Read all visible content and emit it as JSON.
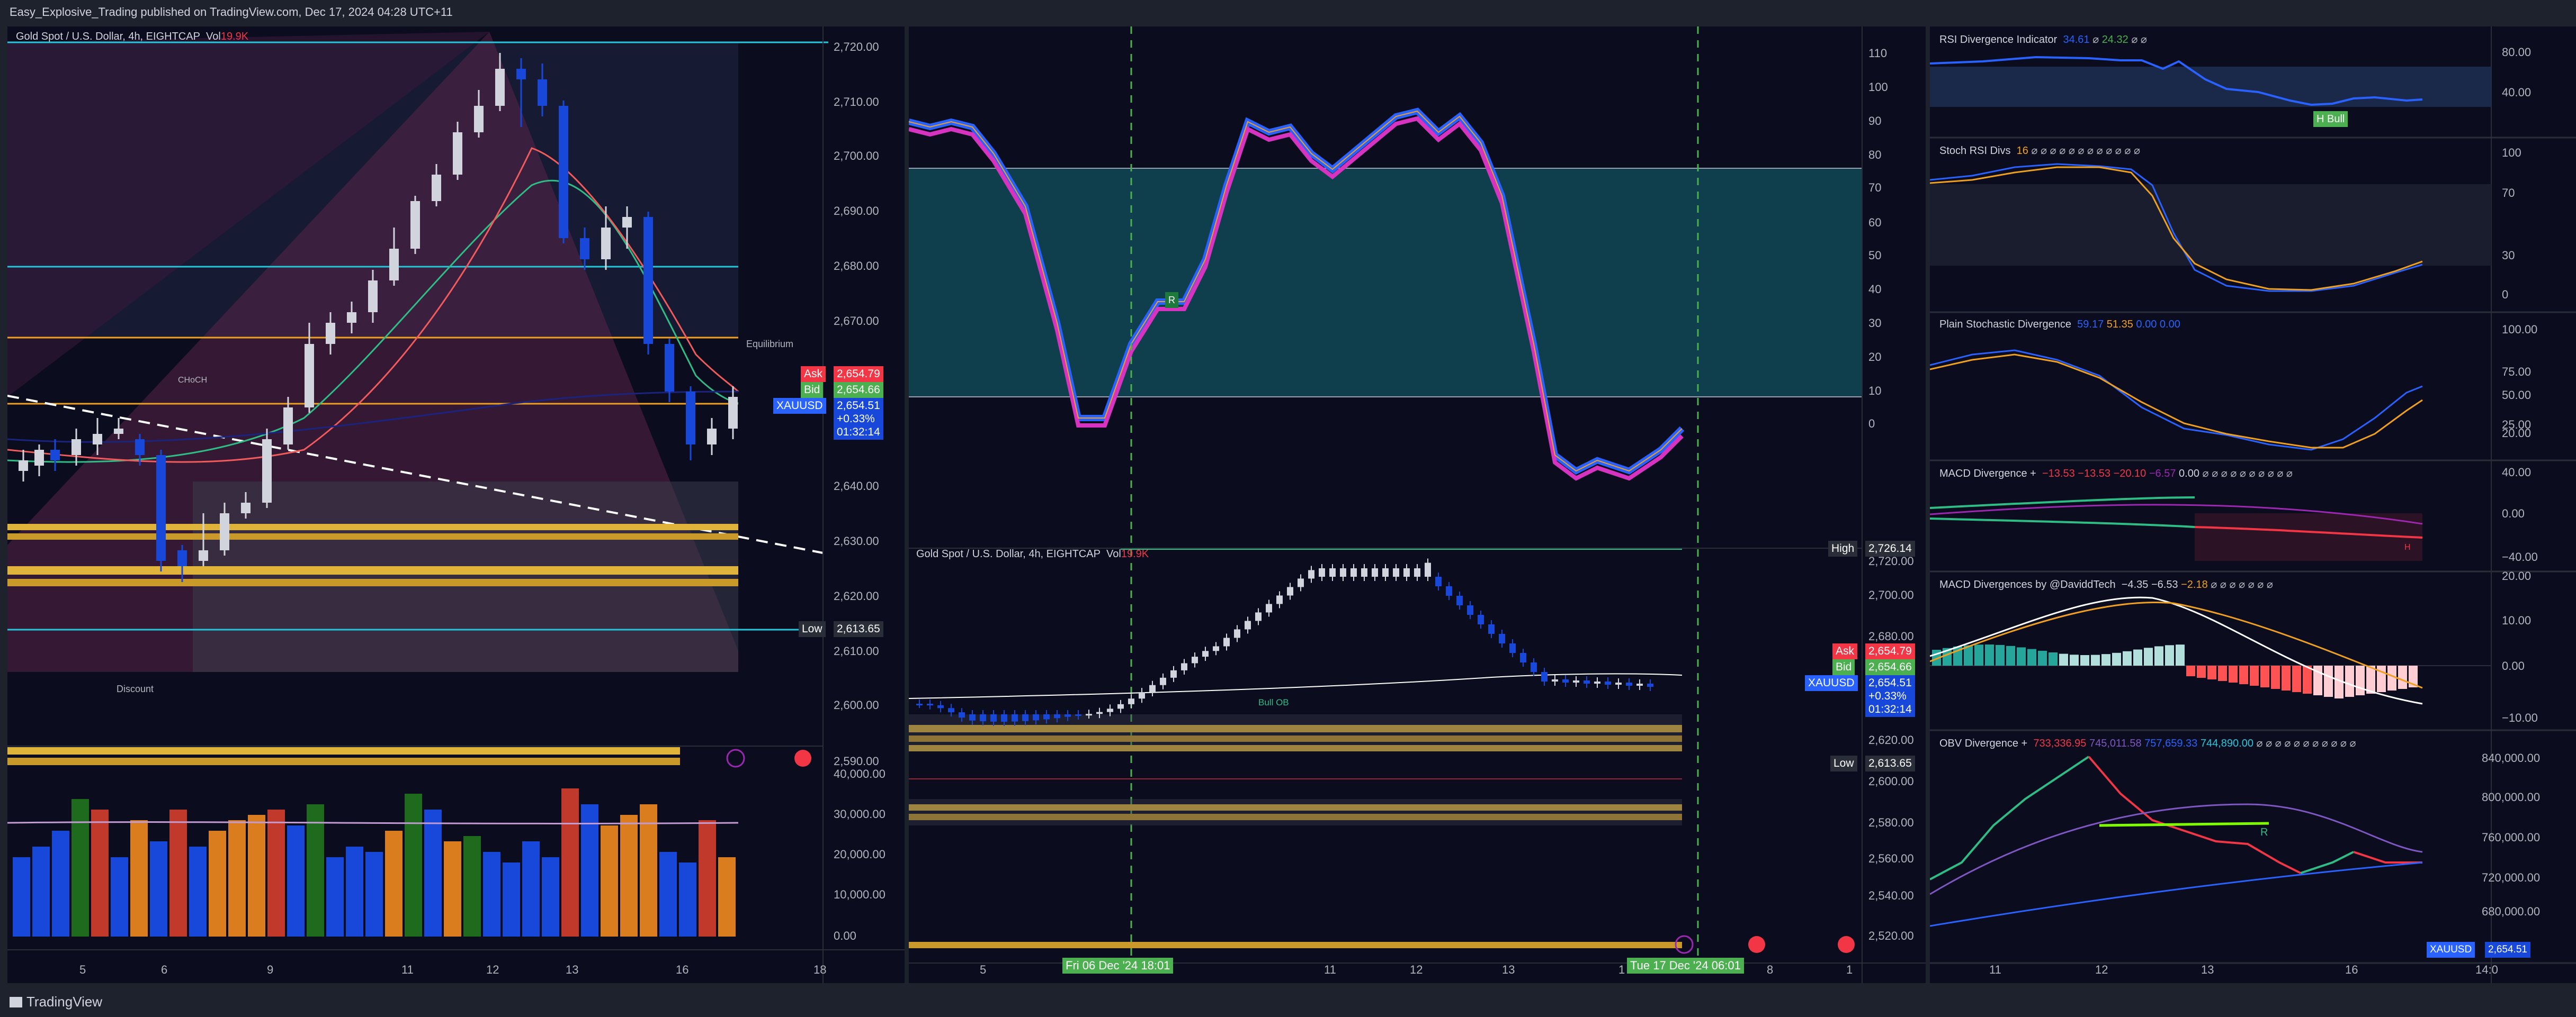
{
  "header": {
    "published": "Easy_Explosive_Trading published on TradingView.com, Dec 17, 2024 04:28 UTC+11"
  },
  "colors": {
    "bg": "#0b0d1e",
    "up": "#d1d4dc",
    "down": "#1848d9",
    "sell": "#f23645",
    "buy": "#4caf50",
    "accent": "#2962ff",
    "gold": "#d4a52a"
  },
  "left_chart": {
    "title": "Gold Spot / U.S. Dollar, 4h, EIGHTCAP",
    "vol_label": "Vol",
    "vol_value": "19.9K",
    "price_axis": [
      "2,720.00",
      "2,710.00",
      "2,700.00",
      "2,690.00",
      "2,680.00",
      "2,670.00",
      "2,640.00",
      "2,630.00",
      "2,620.00",
      "2,610.00",
      "2,600.00",
      "2,590.00"
    ],
    "vol_axis": [
      "40,000.00",
      "30,000.00",
      "20,000.00",
      "10,000.00",
      "0.00"
    ],
    "time_axis": [
      "5",
      "6",
      "9",
      "11",
      "12",
      "13",
      "16",
      "18"
    ],
    "ask_label": "Ask",
    "ask_value": "2,654.79",
    "bid_label": "Bid",
    "bid_value": "2,654.66",
    "symbol": "XAUUSD",
    "last": "2,654.51",
    "change": "+0.33%",
    "countdown": "01:32:14",
    "low_label": "Low",
    "low_value": "2,613.65",
    "choch": "CHoCH",
    "equilibrium": "Equilibrium",
    "discount": "Discount"
  },
  "middle_chart": {
    "osc_axis": [
      "110",
      "100",
      "90",
      "80",
      "70",
      "60",
      "50",
      "40",
      "30",
      "20",
      "10",
      "0"
    ],
    "osc_marker": "R",
    "title": "Gold Spot / U.S. Dollar, 4h, EIGHTCAP",
    "vol_label": "Vol",
    "vol_value": "19.9K",
    "price_axis": [
      "2,720.00",
      "2,700.00",
      "2,680.00",
      "2,660.00",
      "2,640.00",
      "2,620.00",
      "2,600.00",
      "2,580.00",
      "2,560.00",
      "2,540.00",
      "2,520.00"
    ],
    "high_label": "High",
    "high_value": "2,726.14",
    "ask_label": "Ask",
    "ask_value": "2,654.79",
    "bid_label": "Bid",
    "bid_value": "2,654.66",
    "symbol": "XAUUSD",
    "last": "2,654.51",
    "change": "+0.33%",
    "countdown": "01:32:14",
    "low_label": "Low",
    "low_value": "2,613.65",
    "bull_ob": "Bull OB",
    "time_axis": [
      "5",
      "11",
      "12",
      "13",
      "1",
      "8",
      "1"
    ],
    "cursor_left": "Fri 06 Dec '24   18:01",
    "cursor_right": "Tue 17 Dec '24   06:01"
  },
  "right_panes": {
    "rsi": {
      "title": "RSI Divergence Indicator",
      "v1": "34.61",
      "v2": "24.32",
      "axis": [
        "80.00",
        "40.00"
      ],
      "label": "H Bull"
    },
    "stochrsi": {
      "title": "Stoch RSI Divs",
      "v1": "16",
      "axis": [
        "100",
        "70",
        "30",
        "0"
      ]
    },
    "plainstoch": {
      "title": "Plain Stochastic Divergence",
      "v1": "59.17",
      "v2": "51.35",
      "v3": "0.00",
      "v4": "0.00",
      "axis": [
        "100.00",
        "75.00",
        "50.00",
        "25.00",
        "20.00"
      ]
    },
    "macd1": {
      "title": "MACD Divergence +",
      "v1": "−13.53",
      "v2": "−13.53",
      "v3": "−20.10",
      "v4": "−6.57",
      "v5": "0.00",
      "axis": [
        "40.00",
        "0.00",
        "−40.00"
      ],
      "label": "H"
    },
    "macd2": {
      "title": "MACD Divergences by @DaviddTech",
      "v1": "−4.35",
      "v2": "−6.53",
      "v3": "−2.18",
      "axis": [
        "20.00",
        "10.00",
        "0.00",
        "−10.00"
      ]
    },
    "obv": {
      "title": "OBV Divergence +",
      "v1": "733,336.95",
      "v2": "745,011.58",
      "v3": "757,659.33",
      "v4": "744,890.00",
      "axis": [
        "840,000.00",
        "800,000.00",
        "760,000.00",
        "720,000.00",
        "680,000.00"
      ],
      "label": "R",
      "symbol": "XAUUSD",
      "last": "2,654.51"
    },
    "time_axis": [
      "11",
      "12",
      "13",
      "16",
      "14:0"
    ]
  },
  "footer": {
    "brand": "TradingView"
  }
}
